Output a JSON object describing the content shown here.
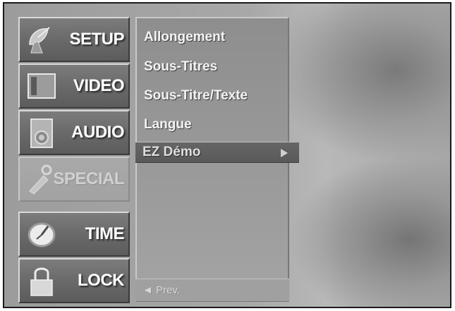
{
  "tabs": [
    {
      "label": "SETUP",
      "icon": "satellite-dish-icon"
    },
    {
      "label": "VIDEO",
      "icon": "monitor-icon"
    },
    {
      "label": "AUDIO",
      "icon": "speaker-icon"
    },
    {
      "label": "SPECIAL",
      "icon": "special-tools-icon"
    },
    {
      "label": "TIME",
      "icon": "clock-icon"
    },
    {
      "label": "LOCK",
      "icon": "padlock-icon"
    }
  ],
  "menu": {
    "items": [
      "Allongement",
      "Sous-Titres",
      "Sous-Titre/Texte",
      "Langue"
    ],
    "selected": "EZ Démo",
    "prev": "◄ Prev."
  },
  "colors": {
    "active_tab": "#6a6a6a",
    "dim_tab": "#a6a6a6",
    "text": "#ffffff"
  }
}
